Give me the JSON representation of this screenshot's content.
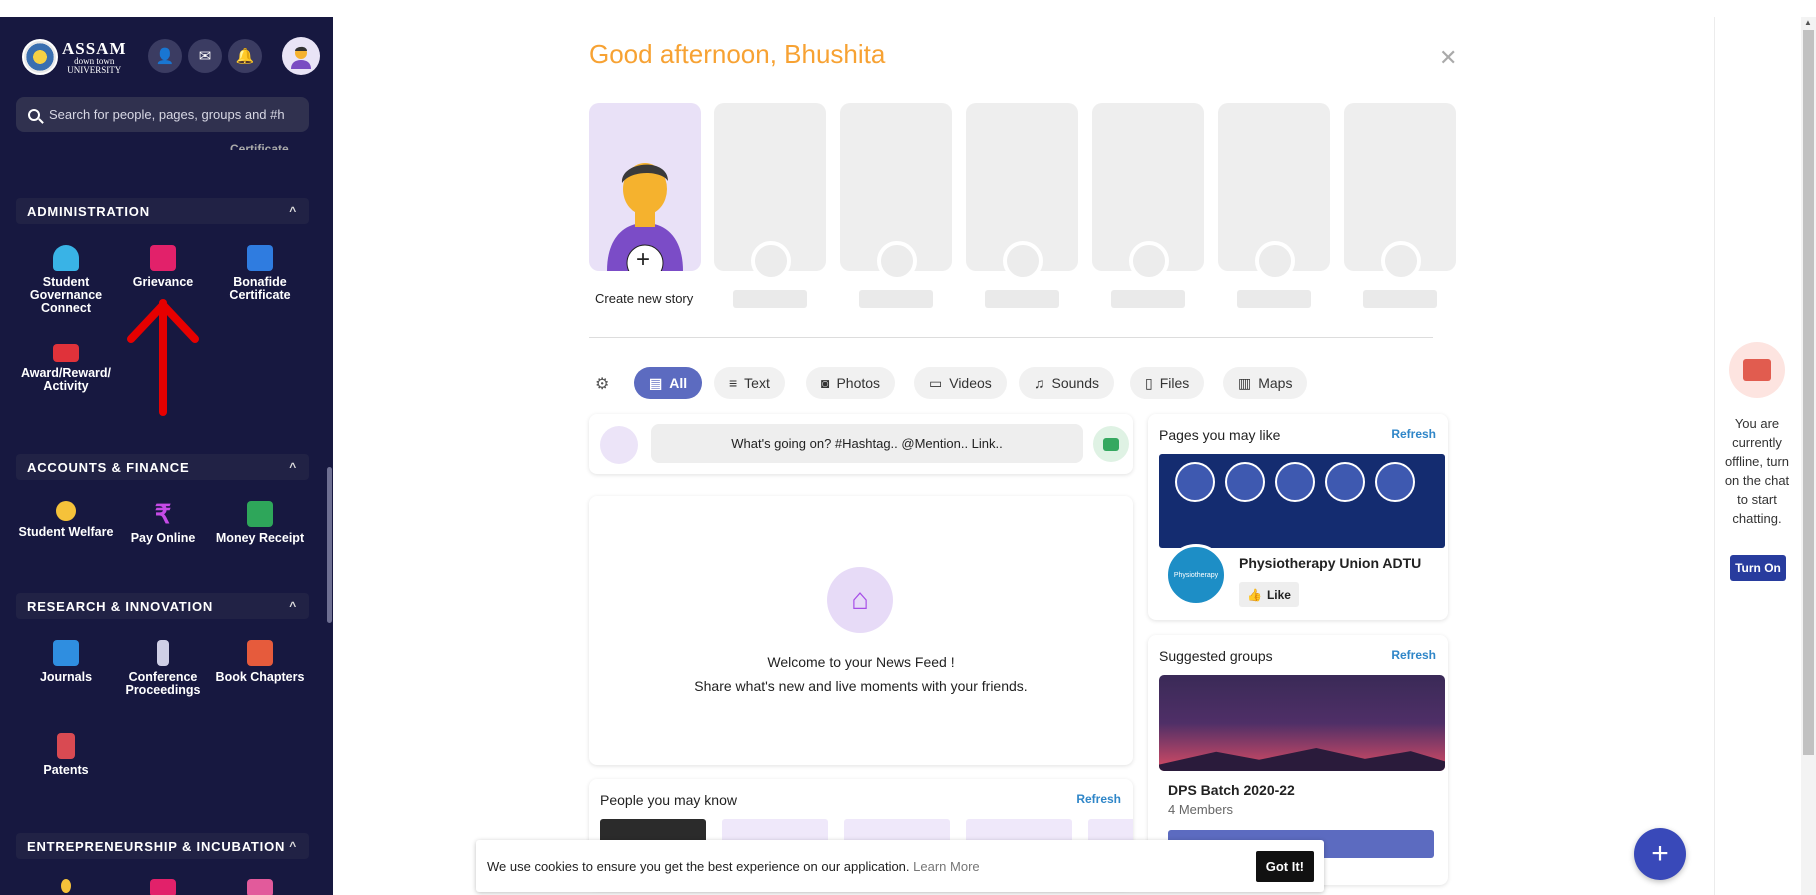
{
  "header": {
    "logo_main": "ASSAM",
    "logo_sub": "down town",
    "logo_sub2": "UNIVERSITY"
  },
  "search": {
    "placeholder": "Search for people, pages, groups and #h"
  },
  "cutoff_label": "Certificate",
  "sections": {
    "admin": {
      "title": "ADMINISTRATION",
      "items": [
        "Student Governance Connect",
        "Grievance",
        "Bonafide Certificate",
        "Award/Reward/ Activity"
      ]
    },
    "accounts": {
      "title": "ACCOUNTS & FINANCE",
      "items": [
        "Student Welfare",
        "Pay Online",
        "Money Receipt"
      ]
    },
    "research": {
      "title": "RESEARCH & INNOVATION",
      "items": [
        "Journals",
        "Conference Proceedings",
        "Book Chapters",
        "Patents"
      ]
    },
    "entre": {
      "title": "ENTREPRENEURSHIP & INCUBATION"
    }
  },
  "main": {
    "greeting": "Good afternoon, Bhushita",
    "create_story": "Create new story",
    "filters": [
      "All",
      "Text",
      "Photos",
      "Videos",
      "Sounds",
      "Files",
      "Maps"
    ],
    "compose_placeholder": "What's going on? #Hashtag.. @Mention.. Link..",
    "feed_welcome": "Welcome to your News Feed !",
    "feed_sub": "Share what's new and live moments with your friends.",
    "people_title": "People you may know",
    "refresh": "Refresh"
  },
  "right_column": {
    "pages_title": "Pages you may like",
    "page_name": "Physiotherapy Union ADTU",
    "page_logo_text": "Physiotherapy",
    "like_label": "Like",
    "groups_title": "Suggested groups",
    "group_name": "DPS Batch 2020-22",
    "group_members": "4 Members"
  },
  "cookie": {
    "text": "We use cookies to ensure you get the best experience on our application.",
    "link": "Learn More",
    "button": "Got It!"
  },
  "chat": {
    "offline_text": "You are currently offline, turn on the chat to start chatting.",
    "turn_on": "Turn On"
  },
  "colors": {
    "sidebar": "#171840",
    "accent": "#5c6bc0",
    "greeting": "#f7a233",
    "annotation": "#e60000"
  }
}
